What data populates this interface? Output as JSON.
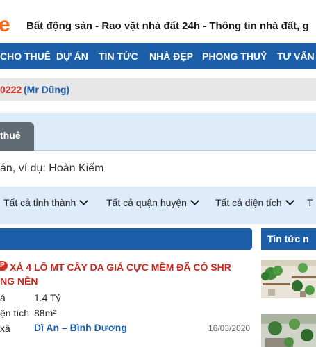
{
  "header": {
    "logo_fragment": "e",
    "tagline": "Bất động sản - Rao vặt nhà đất 24h - Thông tin nhà đất, g"
  },
  "nav": {
    "items": [
      "CHO THUÊ",
      "DỰ ÁN",
      "TIN TỨC",
      "NHÀ ĐẸP",
      "PHONG THUỶ",
      "TƯ VẤN"
    ]
  },
  "hotline": {
    "number": "0222",
    "contact": "(Mr Dũng)"
  },
  "search": {
    "active_tab": "thuê",
    "placeholder": "án, ví dụ: Hoàn Kiếm",
    "filters": [
      "Tất cả tỉnh thành",
      "Tất cả quận huyện",
      "Tất cả diện tích",
      "T"
    ]
  },
  "listing": {
    "badge": "P",
    "title_line1": "XẢ 4 LÔ MT CÂY DA GIÁ CỰC MỀM ĐÃ CÓ SHR",
    "title_line2": "NG NỀN",
    "price_label": "á",
    "price_value": "1.4 Tỷ",
    "area_label": "ện tích",
    "area_value": "88m²",
    "location_label": "xã",
    "location_value": "Dĩ An – Bình Dương",
    "date": "16/03/2020"
  },
  "sidebar": {
    "news_header": "Tin tức n"
  },
  "colors": {
    "brand_blue": "#1c5fa8",
    "accent_red": "#c8281f",
    "logo_orange": "#f26a1b",
    "panel_blue": "#ddebfb"
  }
}
